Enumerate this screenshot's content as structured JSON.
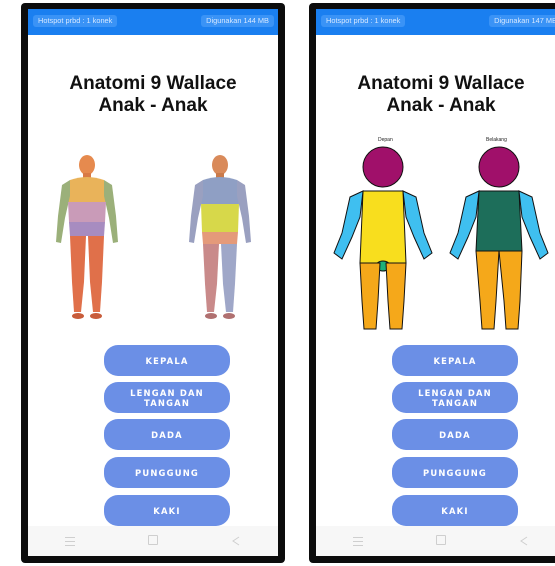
{
  "screens": [
    {
      "status_left": "Hotspot prbd : 1 konek",
      "status_right": "Digunakan 144 MB",
      "title_line1": "Anatomi 9 Wallace",
      "title_line2": "Anak - Anak",
      "buttons": [
        "KEPALA",
        "LENGAN DAN TANGAN",
        "DADA",
        "PUNGGUNG",
        "KAKI"
      ]
    },
    {
      "status_left": "Hotspot prbd : 1 konek",
      "status_right": "Digunakan 147 MB",
      "title_line1": "Anatomi 9 Wallace",
      "title_line2": "Anak - Anak",
      "front_label": "Depan",
      "back_label": "Belakang",
      "buttons": [
        "KEPALA",
        "LENGAN DAN TANGAN",
        "DADA",
        "PUNGGUNG",
        "KAKI"
      ]
    }
  ],
  "colors": {
    "statusbar": "#1a7ff0",
    "button": "#6b8fe6",
    "head": "#a0106a",
    "arms": "#3fbff0",
    "chest": "#f8de1e",
    "back": "#1d6e5a",
    "legs": "#f5a81a",
    "groin": "#1cb07a"
  }
}
